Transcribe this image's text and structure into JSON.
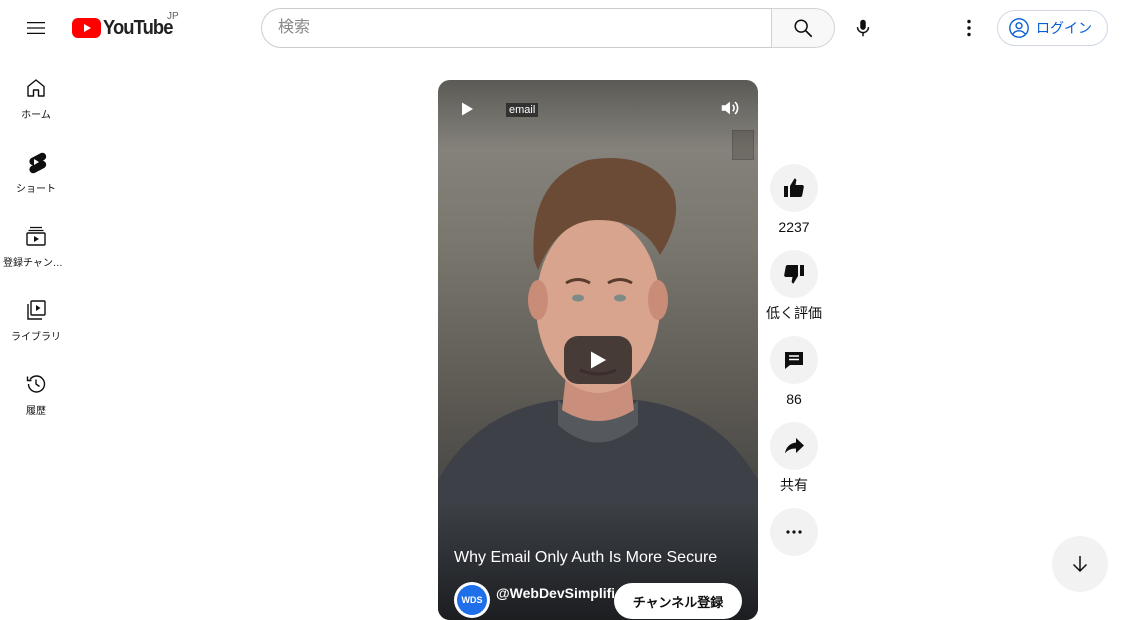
{
  "header": {
    "logo_text": "YouTube",
    "country_code": "JP",
    "search_placeholder": "検索",
    "login_label": "ログイン"
  },
  "sidebar": {
    "items": [
      {
        "label": "ホーム",
        "icon": "home-icon"
      },
      {
        "label": "ショート",
        "icon": "shorts-icon"
      },
      {
        "label": "登録チャンネル",
        "icon": "subscriptions-icon"
      },
      {
        "label": "ライブラリ",
        "icon": "library-icon"
      },
      {
        "label": "履歴",
        "icon": "history-icon"
      }
    ]
  },
  "player": {
    "overlay_tag": "email",
    "title": "Why Email Only Auth Is More Secure",
    "channel": "@WebDevSimplified",
    "channel_avatar_text": "WDS",
    "subscribe_label": "チャンネル登録"
  },
  "actions": {
    "like_count": "2237",
    "dislike_label": "低く評価",
    "comment_count": "86",
    "share_label": "共有"
  },
  "colors": {
    "brand_red": "#ff0000",
    "link_blue": "#065fd4"
  }
}
